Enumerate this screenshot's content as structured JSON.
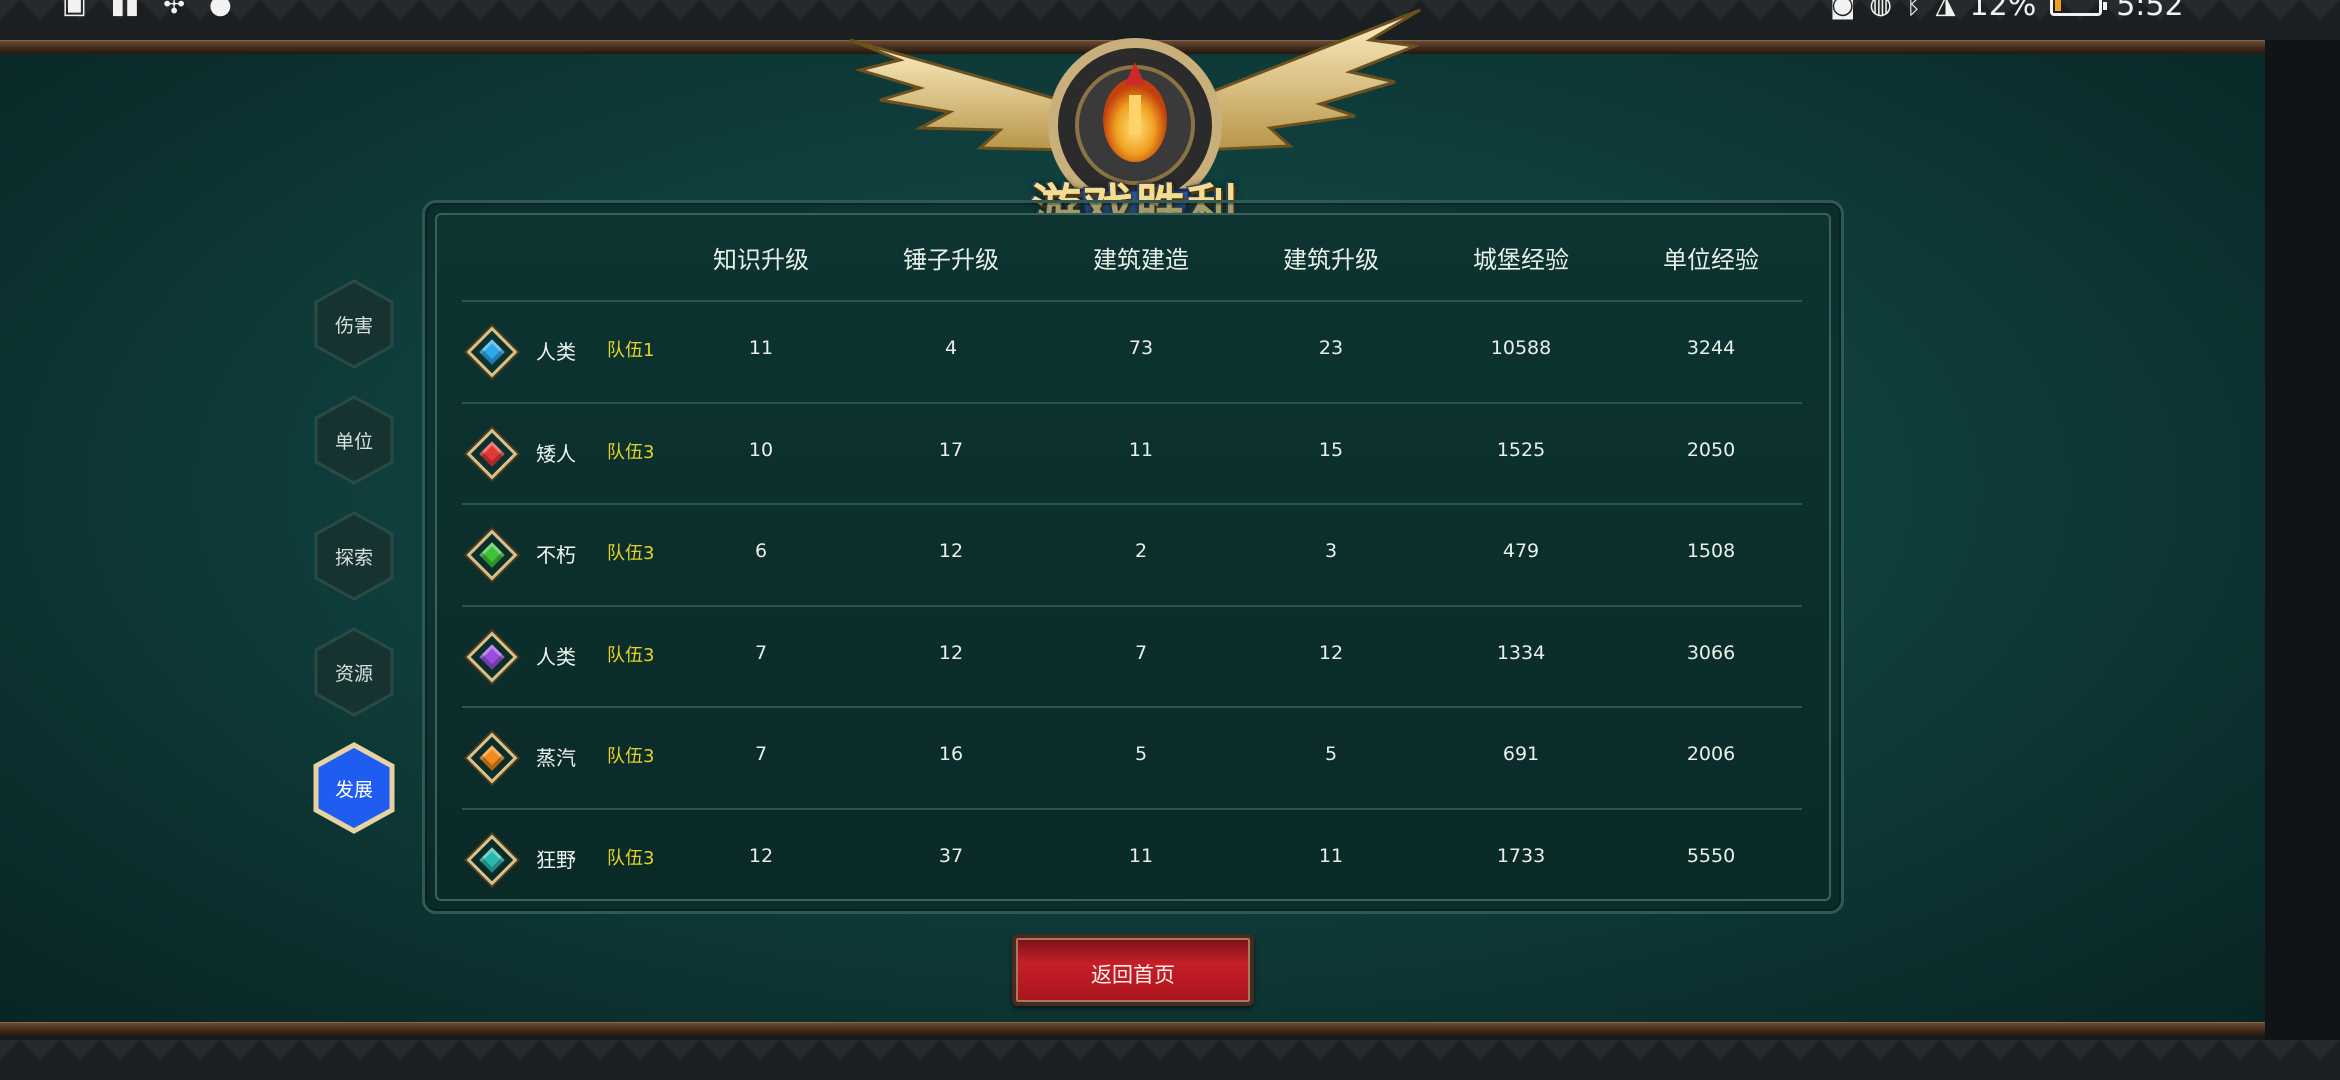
{
  "status_bar": {
    "time": "5:52",
    "battery_percent": "12%",
    "battery_level": 0.12,
    "battery_color": "#f0a020"
  },
  "title": "游戏胜利",
  "side_tabs": [
    {
      "label": "伤害",
      "active": false
    },
    {
      "label": "单位",
      "active": false
    },
    {
      "label": "探索",
      "active": false
    },
    {
      "label": "资源",
      "active": false
    },
    {
      "label": "发展",
      "active": true
    }
  ],
  "table": {
    "headers": [
      "知识升级",
      "锤子升级",
      "建筑建造",
      "建筑升级",
      "城堡经验",
      "单位经验"
    ],
    "rows": [
      {
        "gem_color": "#2aa8e8",
        "gem_icon": "blue-gem-icon",
        "race": "人类",
        "team": "队伍1",
        "values": [
          "11",
          "4",
          "73",
          "23",
          "10588",
          "3244"
        ]
      },
      {
        "gem_color": "#e23838",
        "gem_icon": "red-gem-icon",
        "race": "矮人",
        "team": "队伍3",
        "values": [
          "10",
          "17",
          "11",
          "15",
          "1525",
          "2050"
        ]
      },
      {
        "gem_color": "#3ec23a",
        "gem_icon": "green-gem-icon",
        "race": "不朽",
        "team": "队伍3",
        "values": [
          "6",
          "12",
          "2",
          "3",
          "479",
          "1508"
        ]
      },
      {
        "gem_color": "#9a4ee0",
        "gem_icon": "purple-gem-icon",
        "race": "人类",
        "team": "队伍3",
        "values": [
          "7",
          "12",
          "7",
          "12",
          "1334",
          "3066"
        ]
      },
      {
        "gem_color": "#f08a1a",
        "gem_icon": "orange-gem-icon",
        "race": "蒸汽",
        "team": "队伍3",
        "values": [
          "7",
          "16",
          "5",
          "5",
          "691",
          "2006"
        ]
      },
      {
        "gem_color": "#2ab8a8",
        "gem_icon": "teal-gem-icon",
        "race": "狂野",
        "team": "队伍3",
        "values": [
          "12",
          "37",
          "11",
          "11",
          "1733",
          "5550"
        ]
      }
    ]
  },
  "return_button_label": "返回首页",
  "colors": {
    "team_label": "#e6d22a",
    "active_tab": "#1f5cf0",
    "return_button": "#c61f28"
  }
}
